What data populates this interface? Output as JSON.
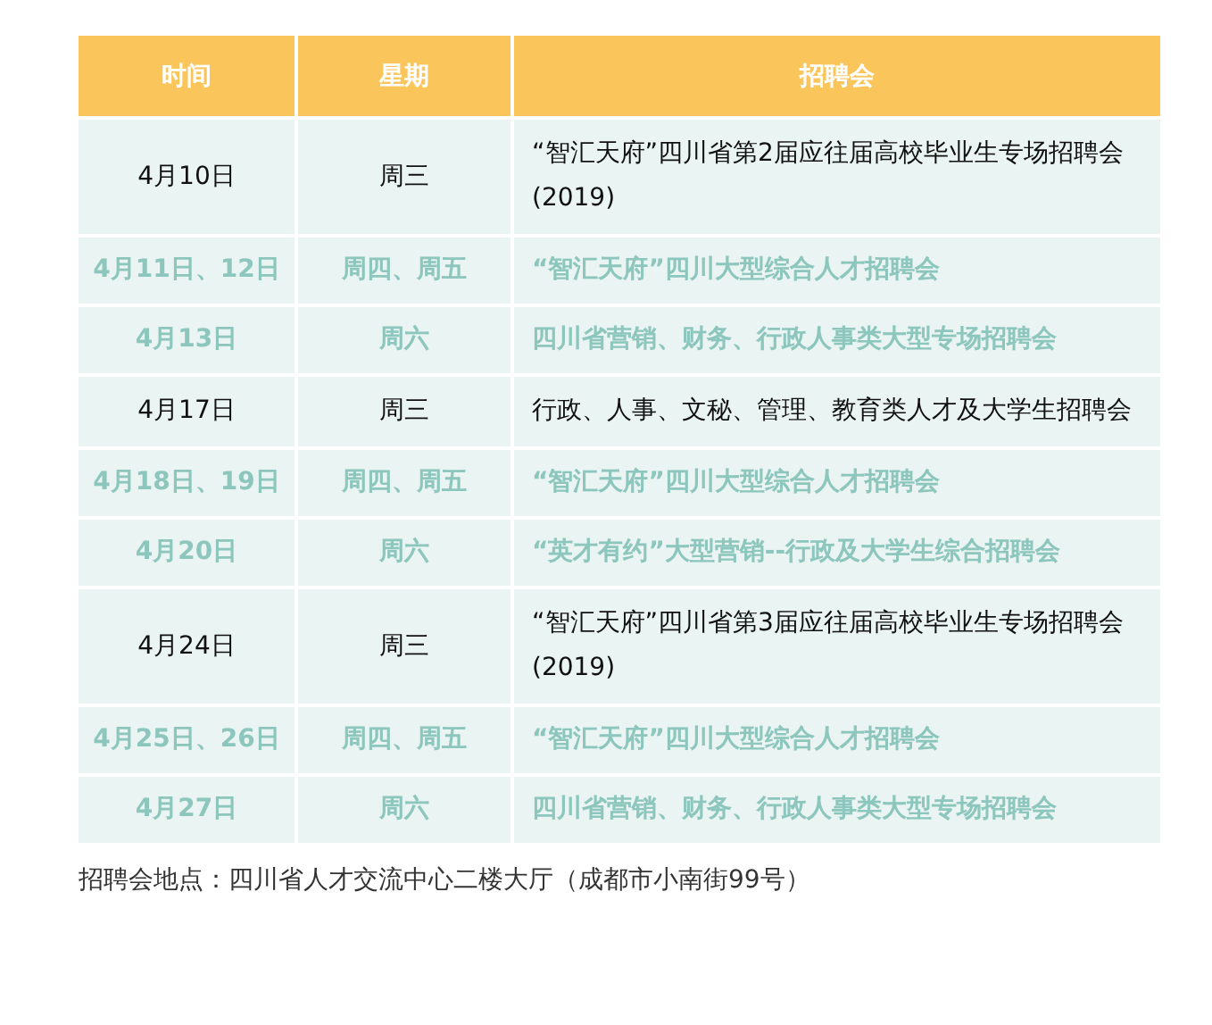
{
  "table": {
    "columns": [
      "时间",
      "星期",
      "招聘会"
    ],
    "rows": [
      {
        "date": "4月10日",
        "weekday": "周三",
        "fair": "“智汇天府”四川省第2届应往届高校毕业生专场招聘会(2019)",
        "highlighted": false
      },
      {
        "date": "4月11日、12日",
        "weekday": "周四、周五",
        "fair": "“智汇天府”四川大型综合人才招聘会",
        "highlighted": true
      },
      {
        "date": "4月13日",
        "weekday": "周六",
        "fair": "四川省营销、财务、行政人事类大型专场招聘会",
        "highlighted": true
      },
      {
        "date": "4月17日",
        "weekday": "周三",
        "fair": "行政、人事、文秘、管理、教育类人才及大学生招聘会",
        "highlighted": false
      },
      {
        "date": "4月18日、19日",
        "weekday": "周四、周五",
        "fair": "“智汇天府”四川大型综合人才招聘会",
        "highlighted": true
      },
      {
        "date": "4月20日",
        "weekday": "周六",
        "fair": "“英才有约”大型营销--行政及大学生综合招聘会",
        "highlighted": true
      },
      {
        "date": "4月24日",
        "weekday": "周三",
        "fair": "“智汇天府”四川省第3届应往届高校毕业生专场招聘会(2019)",
        "highlighted": false
      },
      {
        "date": "4月25日、26日",
        "weekday": "周四、周五",
        "fair": "“智汇天府”四川大型综合人才招聘会",
        "highlighted": true
      },
      {
        "date": "4月27日",
        "weekday": "周六",
        "fair": "四川省营销、财务、行政人事类大型专场招聘会",
        "highlighted": true
      }
    ]
  },
  "footer": "招聘会地点：四川省人才交流中心二楼大厅（成都市小南街99号）"
}
